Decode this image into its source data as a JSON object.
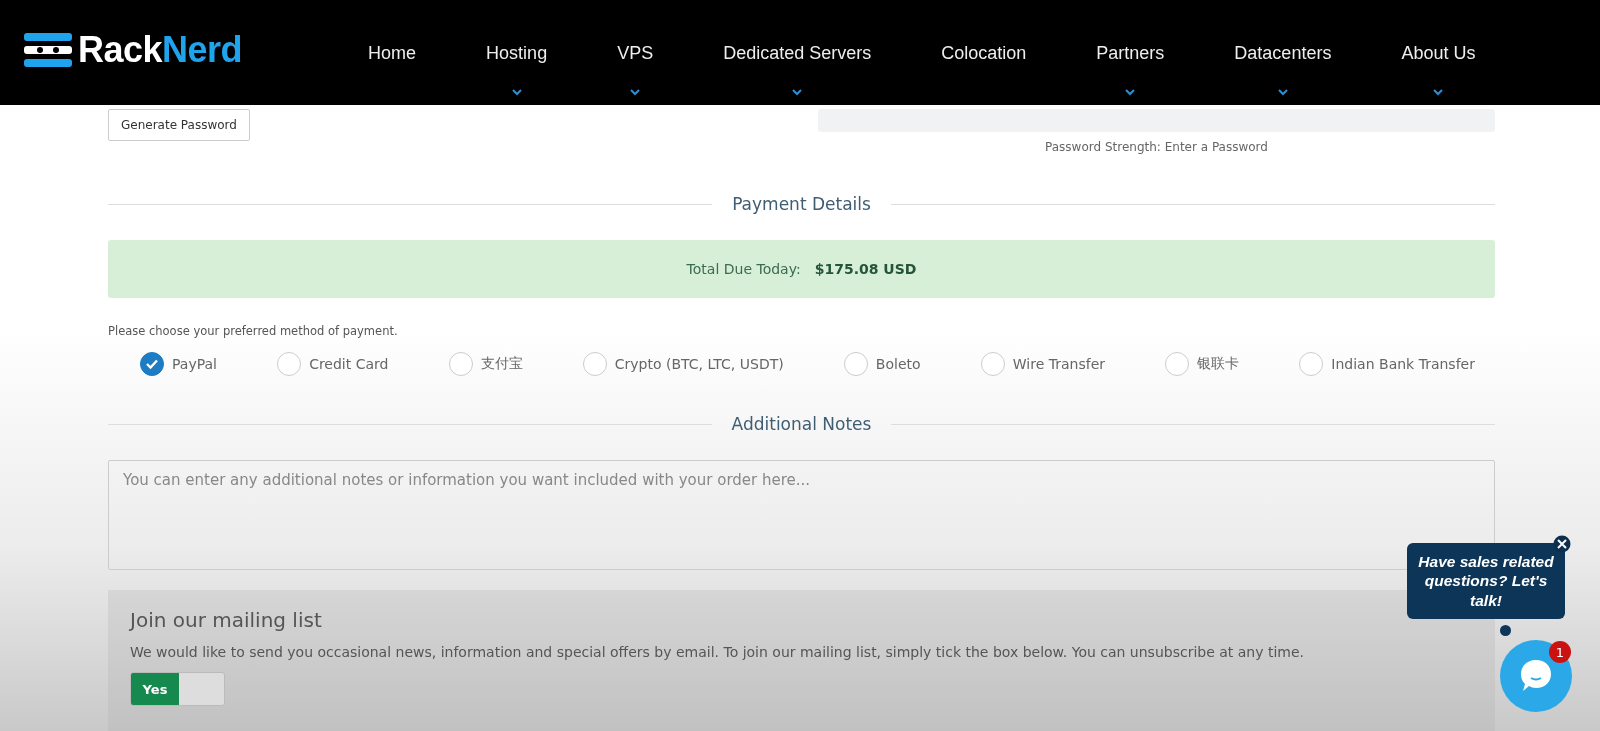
{
  "header": {
    "logo_left": "Rack",
    "logo_right": "Nerd",
    "nav": [
      {
        "label": "Home",
        "has_dropdown": false
      },
      {
        "label": "Hosting",
        "has_dropdown": true
      },
      {
        "label": "VPS",
        "has_dropdown": true
      },
      {
        "label": "Dedicated Servers",
        "has_dropdown": true
      },
      {
        "label": "Colocation",
        "has_dropdown": false
      },
      {
        "label": "Partners",
        "has_dropdown": true
      },
      {
        "label": "Datacenters",
        "has_dropdown": true
      },
      {
        "label": "About Us",
        "has_dropdown": true
      }
    ]
  },
  "password": {
    "generate_button": "Generate Password",
    "strength_text": "Password Strength: Enter a Password"
  },
  "payment": {
    "heading": "Payment Details",
    "total_label": "Total Due Today:",
    "total_value": "$175.08 USD",
    "prompt": "Please choose your preferred method of payment.",
    "methods": [
      {
        "label": "PayPal",
        "selected": true
      },
      {
        "label": "Credit Card",
        "selected": false
      },
      {
        "label": "支付宝",
        "selected": false
      },
      {
        "label": "Crypto (BTC, LTC, USDT)",
        "selected": false
      },
      {
        "label": "Boleto",
        "selected": false
      },
      {
        "label": "Wire Transfer",
        "selected": false
      },
      {
        "label": "银联卡",
        "selected": false
      },
      {
        "label": "Indian Bank Transfer",
        "selected": false
      }
    ]
  },
  "notes": {
    "heading": "Additional Notes",
    "placeholder": "You can enter any additional notes or information you want included with your order here..."
  },
  "mailing": {
    "title": "Join our mailing list",
    "text": "We would like to send you occasional news, information and special offers by email. To join our mailing list, simply tick the box below. You can unsubscribe at any time.",
    "toggle_label": "Yes",
    "on": true
  },
  "chat": {
    "bubble": "Have sales related questions? Let's talk!",
    "badge": "1"
  }
}
